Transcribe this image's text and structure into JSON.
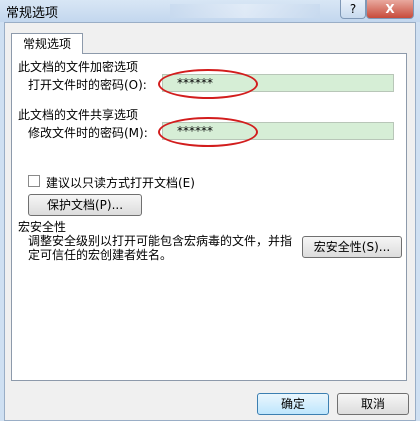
{
  "window": {
    "title": "常规选项"
  },
  "titlebar": {
    "help_label": "?",
    "close_label": "X"
  },
  "tab": {
    "label": "常规选项"
  },
  "encrypt": {
    "section_title": "此文档的文件加密选项",
    "label": "打开文件时的密码(O):",
    "value": "******"
  },
  "share": {
    "section_title": "此文档的文件共享选项",
    "label": "修改文件时的密码(M):",
    "value": "******",
    "readonly_label": "建议以只读方式打开文档(E)",
    "readonly_checked": false,
    "protect_button": "保护文档(P)..."
  },
  "macro": {
    "section_title": "宏安全性",
    "description": "调整安全级别以打开可能包含宏病毒的文件，并指定可信任的宏创建者姓名。",
    "button": "宏安全性(S)..."
  },
  "footer": {
    "ok_button": "确定",
    "cancel_button": "取消"
  },
  "colors": {
    "password_bg": "#d6eed6",
    "highlight_oval": "#d21d1d"
  }
}
